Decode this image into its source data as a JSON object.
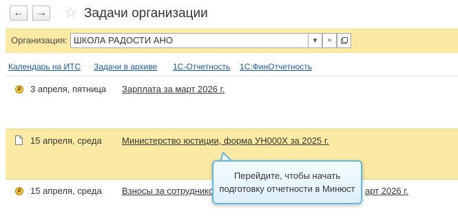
{
  "header": {
    "back_icon": "arrow-left-icon",
    "forward_icon": "arrow-right-icon",
    "favorite_icon": "star-icon",
    "title": "Задачи организации"
  },
  "org_filter": {
    "label": "Организация:",
    "value": "ШКОЛА РАДОСТИ АНО",
    "dropdown_icon": "chevron-down-icon",
    "clear_icon": "close-icon",
    "open_icon": "open-window-icon"
  },
  "links": [
    {
      "label": "Календарь на ИТС"
    },
    {
      "label": "Задачи в архиве"
    },
    {
      "label": "1С-Отчетность"
    },
    {
      "label": "1С:ФинОтчетность"
    }
  ],
  "tasks": [
    {
      "icon": "coin-icon",
      "date": "3 апреля, пятница",
      "title": "Зарплата за март 2026 г."
    },
    {
      "icon": "document-icon",
      "date": "15 апреля, среда",
      "title": "Министерство юстиции, форма УН000Х за 2025 г."
    },
    {
      "icon": "coin-icon",
      "date": "15 апреля, среда",
      "title_left": "Взносы за сотруднико",
      "title_right": "арт 2026 г."
    }
  ],
  "tooltip": {
    "text": "Перейдите, чтобы начать подготовку отчетности в Минюст"
  },
  "colors": {
    "highlight": "#fbeaa4",
    "link": "#1a57a6",
    "tooltip_border": "#5fb9e4"
  }
}
